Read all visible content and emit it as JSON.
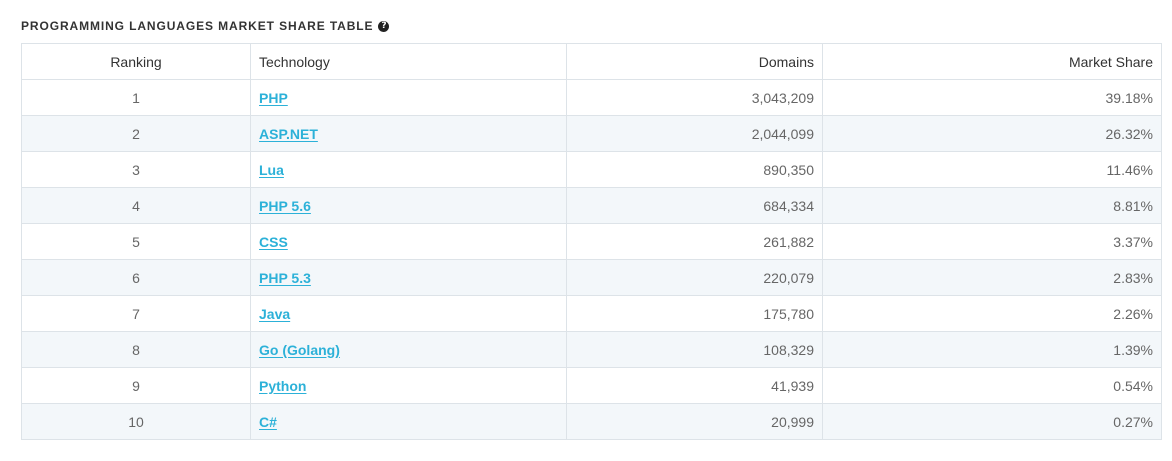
{
  "header": {
    "title": "PROGRAMMING LANGUAGES MARKET SHARE TABLE",
    "help_icon": "question-circle-icon"
  },
  "table": {
    "columns": [
      "Ranking",
      "Technology",
      "Domains",
      "Market Share"
    ],
    "rows": [
      {
        "rank": "1",
        "technology": "PHP",
        "domains": "3,043,209",
        "share": "39.18%"
      },
      {
        "rank": "2",
        "technology": "ASP.NET",
        "domains": "2,044,099",
        "share": "26.32%"
      },
      {
        "rank": "3",
        "technology": "Lua",
        "domains": "890,350",
        "share": "11.46%"
      },
      {
        "rank": "4",
        "technology": "PHP 5.6",
        "domains": "684,334",
        "share": "8.81%"
      },
      {
        "rank": "5",
        "technology": "CSS",
        "domains": "261,882",
        "share": "3.37%"
      },
      {
        "rank": "6",
        "technology": "PHP 5.3",
        "domains": "220,079",
        "share": "2.83%"
      },
      {
        "rank": "7",
        "technology": "Java",
        "domains": "175,780",
        "share": "2.26%"
      },
      {
        "rank": "8",
        "technology": "Go (Golang)",
        "domains": "108,329",
        "share": "1.39%"
      },
      {
        "rank": "9",
        "technology": "Python",
        "domains": "41,939",
        "share": "0.54%"
      },
      {
        "rank": "10",
        "technology": "C#",
        "domains": "20,999",
        "share": "0.27%"
      }
    ]
  },
  "colors": {
    "link": "#2cb1d8",
    "stripe": "#f3f7fa",
    "border": "#dde3e8"
  }
}
